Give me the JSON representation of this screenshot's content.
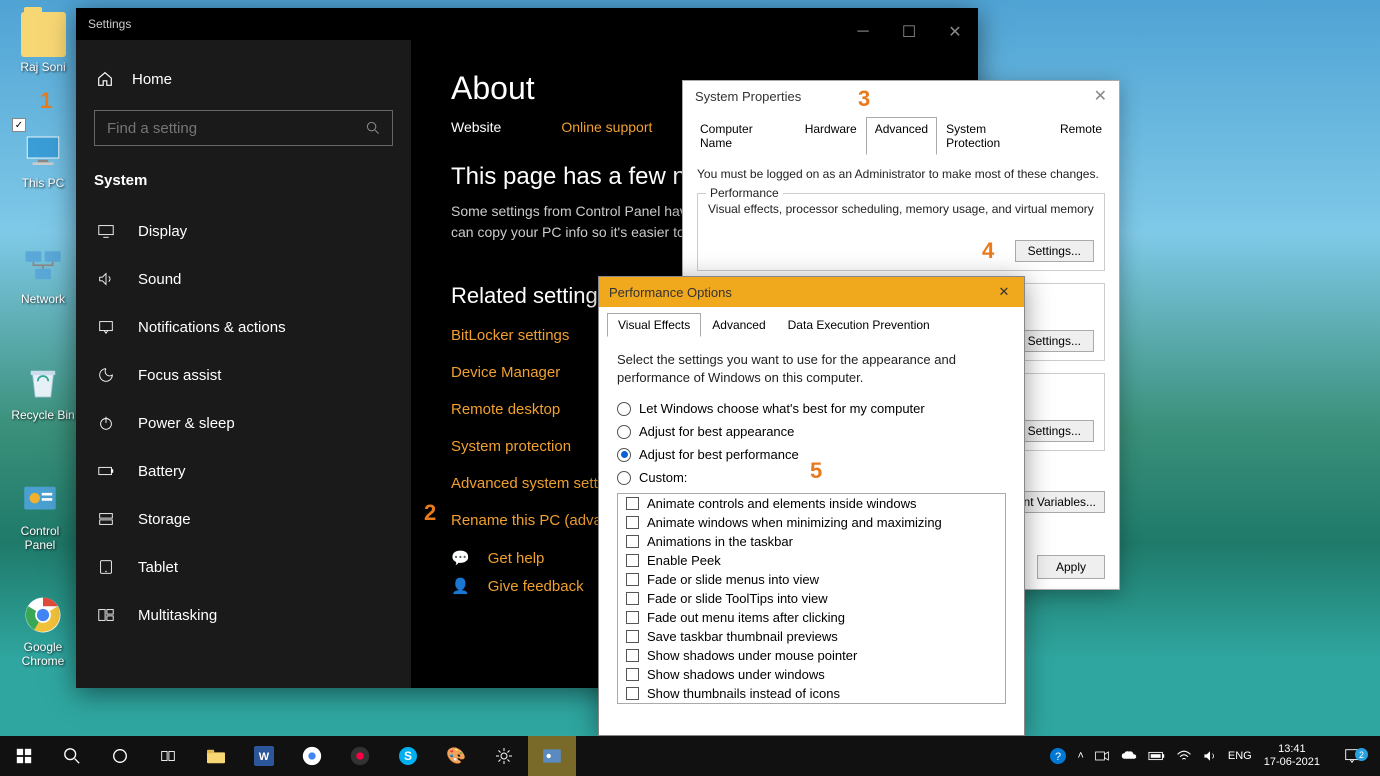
{
  "desktop": {
    "icons": [
      {
        "label": "Raj Soni"
      },
      {
        "label": "This PC"
      },
      {
        "label": "Network"
      },
      {
        "label": "Recycle Bin"
      },
      {
        "label": "Control Panel"
      },
      {
        "label": "Google Chrome"
      }
    ]
  },
  "settings": {
    "title": "Settings",
    "home": "Home",
    "search_placeholder": "Find a setting",
    "category": "System",
    "sidebar_items": [
      "Display",
      "Sound",
      "Notifications & actions",
      "Focus assist",
      "Power & sleep",
      "Battery",
      "Storage",
      "Tablet",
      "Multitasking"
    ],
    "main": {
      "heading": "About",
      "website": "Website",
      "online_support": "Online support",
      "sub_heading": "This page has a few new",
      "sub_para": "Some settings from Control Panel have moved here, and you can copy your PC info so it's easier to share.",
      "related_heading": "Related settings",
      "related_links": [
        "BitLocker settings",
        "Device Manager",
        "Remote desktop",
        "System protection",
        "Advanced system settings",
        "Rename this PC (advanced)"
      ],
      "get_help": "Get help",
      "give_feedback": "Give feedback"
    }
  },
  "sysprops": {
    "title": "System Properties",
    "tabs": [
      "Computer Name",
      "Hardware",
      "Advanced",
      "System Protection",
      "Remote"
    ],
    "active_tab": "Advanced",
    "note": "You must be logged on as an Administrator to make most of these changes.",
    "perf_group": "Performance",
    "perf_desc": "Visual effects, processor scheduling, memory usage, and virtual memory",
    "settings_btn": "Settings...",
    "env_btn": "Environment Variables...",
    "apply": "Apply"
  },
  "perfopts": {
    "title": "Performance Options",
    "tabs": [
      "Visual Effects",
      "Advanced",
      "Data Execution Prevention"
    ],
    "active_tab": "Visual Effects",
    "desc": "Select the settings you want to use for the appearance and performance of Windows on this computer.",
    "radios": [
      "Let Windows choose what's best for my computer",
      "Adjust for best appearance",
      "Adjust for best performance",
      "Custom:"
    ],
    "selected_radio": 2,
    "checks": [
      "Animate controls and elements inside windows",
      "Animate windows when minimizing and maximizing",
      "Animations in the taskbar",
      "Enable Peek",
      "Fade or slide menus into view",
      "Fade or slide ToolTips into view",
      "Fade out menu items after clicking",
      "Save taskbar thumbnail previews",
      "Show shadows under mouse pointer",
      "Show shadows under windows",
      "Show thumbnails instead of icons"
    ]
  },
  "annotations": {
    "n1": "1",
    "n2": "2",
    "n3": "3",
    "n4": "4",
    "n5": "5"
  },
  "taskbar": {
    "lang": "ENG",
    "time": "13:41",
    "date": "17-06-2021",
    "notif_count": "2"
  }
}
